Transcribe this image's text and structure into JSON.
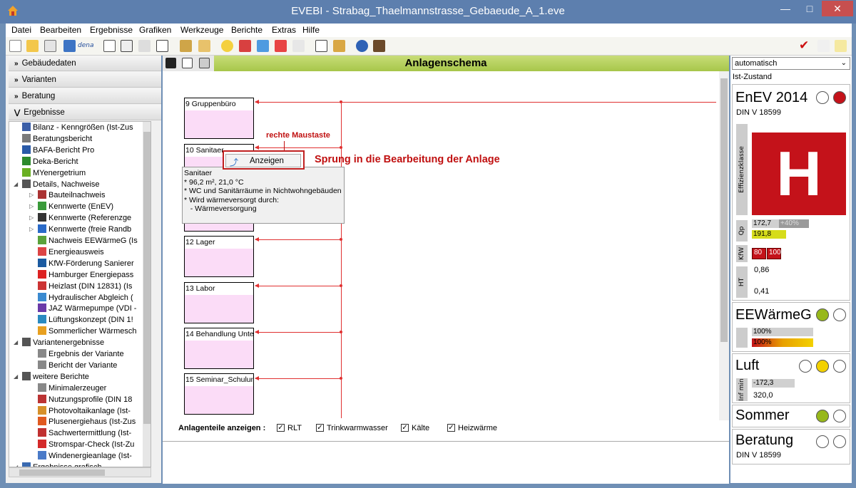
{
  "window": {
    "title": "EVEBI - Strabag_Thaelmannstrasse_Gebaeude_A_1.eve"
  },
  "menu": [
    "Datei",
    "Bearbeiten",
    "Ergebnisse",
    "Grafiken",
    "Werkzeuge",
    "Berichte",
    "Extras",
    "Hilfe"
  ],
  "toolbar": {
    "dena_label": "dena"
  },
  "accordion": [
    "Gebäudedaten",
    "Varianten",
    "Beratung",
    "Ergebnisse"
  ],
  "tree": [
    {
      "label": "Bilanz - Kenngrößen (Ist-Zus",
      "icon": "table-icon",
      "indent": 1
    },
    {
      "label": "Beratungsbericht",
      "icon": "report-icon",
      "indent": 1
    },
    {
      "label": "BAFA-Bericht Pro",
      "icon": "bafa-icon",
      "indent": 1
    },
    {
      "label": "Deka-Bericht",
      "icon": "deka-icon",
      "indent": 1
    },
    {
      "label": "MYenergetrium",
      "icon": "leaf-icon",
      "indent": 1
    },
    {
      "label": "Details, Nachweise",
      "icon": "book-icon",
      "indent": 0
    },
    {
      "label": "Bauteilnachweis",
      "icon": "wall-icon",
      "indent": 2
    },
    {
      "label": "Kennwerte (EnEV)",
      "icon": "chart-green-icon",
      "indent": 2
    },
    {
      "label": "Kennwerte (Referenzge",
      "icon": "chart-dark-icon",
      "indent": 2
    },
    {
      "label": "Kennwerte (freie Randb",
      "icon": "chart-blue-icon",
      "indent": 2
    },
    {
      "label": "Nachweis EEWärmeG (Is",
      "icon": "ee-icon",
      "indent": 2
    },
    {
      "label": "Energieausweis",
      "icon": "certificate-icon",
      "indent": 2
    },
    {
      "label": "KfW-Förderung Sanierer",
      "icon": "kfw-icon",
      "indent": 2
    },
    {
      "label": "Hamburger Energiepass",
      "icon": "hamburg-icon",
      "indent": 2
    },
    {
      "label": "Heizlast (DIN 12831) (Is",
      "icon": "heater-icon",
      "indent": 2
    },
    {
      "label": "Hydraulischer Abgleich (",
      "icon": "hydraulic-icon",
      "indent": 2
    },
    {
      "label": "JAZ Wärmepumpe (VDI -",
      "icon": "jaz-icon",
      "indent": 2
    },
    {
      "label": "Lüftungskonzept (DIN 1!",
      "icon": "ventilation-icon",
      "indent": 2
    },
    {
      "label": "Sommerlicher Wärmesch",
      "icon": "sun-icon",
      "indent": 2
    },
    {
      "label": "Variantenergebnisse",
      "icon": "book-icon",
      "indent": 0
    },
    {
      "label": "Ergebnis der Variante",
      "icon": "doc-icon",
      "indent": 2
    },
    {
      "label": "Bericht der Variante",
      "icon": "doc-icon",
      "indent": 2
    },
    {
      "label": "weitere Berichte",
      "icon": "book-icon",
      "indent": 0
    },
    {
      "label": "Minimalerzeuger",
      "icon": "doc-icon",
      "indent": 2
    },
    {
      "label": "Nutzungsprofile (DIN 18",
      "icon": "profile-icon",
      "indent": 2
    },
    {
      "label": "Photovoltaikanlage (Ist-",
      "icon": "pv-icon",
      "indent": 2
    },
    {
      "label": "Plusenergiehaus (Ist-Zus",
      "icon": "house-icon",
      "indent": 2
    },
    {
      "label": "Sachwertermittlung (Ist-",
      "icon": "value-icon",
      "indent": 2
    },
    {
      "label": "Stromspar-Check (Ist-Zu",
      "icon": "plug-icon",
      "indent": 2
    },
    {
      "label": "Windenergieanlage (Ist-",
      "icon": "wind-icon",
      "indent": 2
    },
    {
      "label": "Ergebnisse grafisch",
      "icon": "graph-icon",
      "indent": 0
    }
  ],
  "schema": {
    "header": "Anlagenschema",
    "boxes": [
      "9 Gruppenbüro",
      "10 Sanitaer",
      "12 Lager",
      "13 Labor",
      "14 Behandlung Unte",
      "15 Seminar_Schulung"
    ],
    "annotation_rmb": "rechte Maustaste",
    "annotation_jump": "Sprung in die Bearbeitung der Anlage",
    "context_item": "Anzeigen",
    "tooltip": [
      "Sanitaer",
      "* 96,2 m², 21,0 °C",
      "* WC und Sanitärräume in Nichtwohngebäuden",
      "* Wird wärmeversorgt durch:",
      "   - Wärmeversorgung"
    ],
    "anlagenteile_label": "Anlagenteile anzeigen :",
    "checkboxes": [
      {
        "label": "RLT",
        "checked": true
      },
      {
        "label": "Trinkwarmwasser",
        "checked": true
      },
      {
        "label": "Kälte",
        "checked": true
      },
      {
        "label": "Heizwärme",
        "checked": true
      }
    ]
  },
  "right": {
    "dropdown": "automatisch",
    "state": "Ist-Zustand",
    "enev": {
      "title": "EnEV 2014",
      "norm": "DIN V 18599",
      "class_label": "Effizienzklasse",
      "class": "H",
      "qp_label": "Qp",
      "qp_value": "172,7",
      "qp_delta": "+40%",
      "qp_ref": "191,8",
      "kfw_label": "KfW",
      "kfw1": "80",
      "kfw2": "100",
      "ht_label": "HT",
      "ht1": "0,86",
      "ht2": "0,41"
    },
    "ee": {
      "title": "EEWärmeG",
      "v1": "100%",
      "v2": "100%"
    },
    "luft": {
      "title": "Luft",
      "label": "Inf min",
      "v1": "-172,3",
      "v2": "320,0"
    },
    "sommer": {
      "title": "Sommer"
    },
    "beratung": {
      "title": "Beratung",
      "norm": "DIN V 18599"
    }
  },
  "colors": {
    "accent_green": "#a7c64a",
    "alert_red": "#c4121a",
    "status_green": "#97b81a",
    "status_yellow": "#f3d100"
  }
}
